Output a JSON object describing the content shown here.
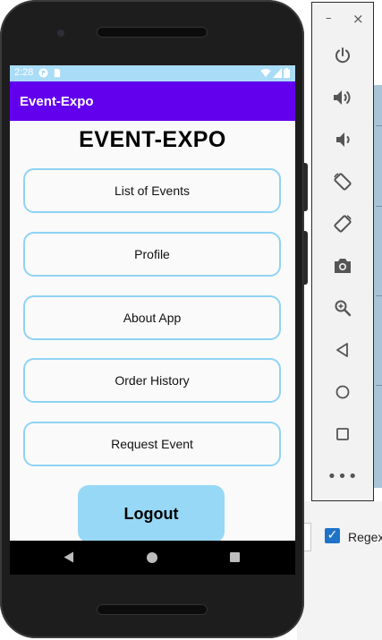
{
  "status_bar": {
    "time": "2:28"
  },
  "app_bar": {
    "title": "Event-Expo"
  },
  "main": {
    "heading": "EVENT-EXPO",
    "menu_buttons": [
      {
        "label": "List of Events"
      },
      {
        "label": "Profile"
      },
      {
        "label": "About App"
      },
      {
        "label": "Order History"
      },
      {
        "label": "Request Event"
      }
    ],
    "logout_label": "Logout"
  },
  "emulator_panel": {
    "minimize_glyph": "–",
    "close_glyph": "×",
    "more_glyph": "•••",
    "tools": [
      "power-icon",
      "volume-up-icon",
      "volume-down-icon",
      "rotate-left-icon",
      "rotate-right-icon",
      "camera-icon",
      "zoom-icon",
      "back-icon",
      "home-icon",
      "overview-icon"
    ]
  },
  "ide": {
    "regex_label": "Regex",
    "regex_checked": true,
    "check_glyph": "✓"
  },
  "colors": {
    "app_bar": "#6200ee",
    "status_bar": "#a9dcf6",
    "button_border": "#8fd3f4",
    "logout_fill": "#97d8f6",
    "checkbox": "#1e73c8"
  }
}
